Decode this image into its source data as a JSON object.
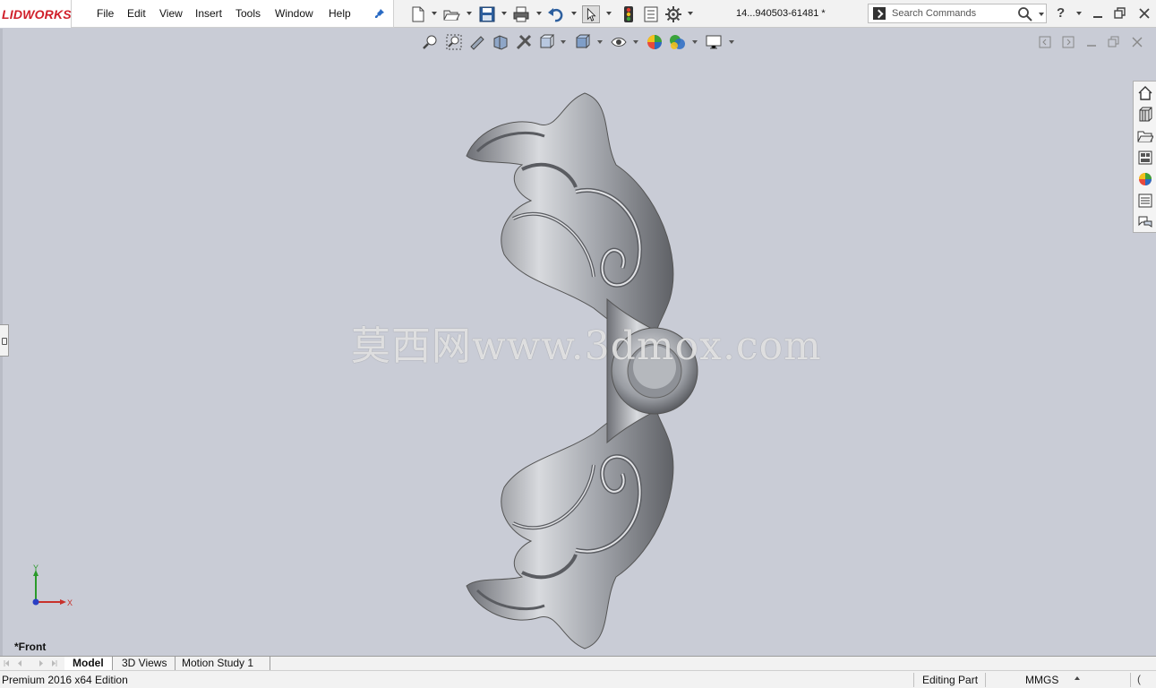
{
  "app": {
    "logo_text": "LIDWORKS",
    "document_title": "14...940503-61481 *"
  },
  "menu": {
    "items": [
      "File",
      "Edit",
      "View",
      "Insert",
      "Tools",
      "Window",
      "Help"
    ],
    "pin_icon": "pin-icon"
  },
  "toolbar": {
    "icons": [
      "new-document-icon",
      "open-icon",
      "save-icon",
      "print-icon",
      "undo-icon",
      "select-icon",
      "rebuild-icon",
      "file-properties-icon",
      "options-icon"
    ]
  },
  "search": {
    "placeholder": "Search Commands"
  },
  "help": {
    "label": "?"
  },
  "heads_up_toolbar": {
    "icons": [
      "zoom-to-fit-icon",
      "zoom-to-area-icon",
      "previous-view-icon",
      "section-view-icon",
      "dynamic-annotation-icon",
      "view-orientation-icon",
      "display-style-icon",
      "hide-show-icon",
      "edit-appearance-icon",
      "apply-scene-icon",
      "view-settings-icon"
    ]
  },
  "task_pane": {
    "icons": [
      "home-icon",
      "design-library-icon",
      "file-explorer-icon",
      "view-palette-icon",
      "appearances-icon",
      "custom-properties-icon",
      "forum-icon"
    ]
  },
  "viewport": {
    "watermark": "莫西网www.3dmox.com",
    "view_name": "*Front",
    "triad": {
      "y_label": "Y",
      "x_label": "X"
    }
  },
  "tabs": [
    {
      "label": "Model",
      "active": true
    },
    {
      "label": "3D Views",
      "active": false
    },
    {
      "label": "Motion Study 1",
      "active": false
    }
  ],
  "status": {
    "edition": "Premium 2016 x64 Edition",
    "mode": "Editing Part",
    "units": "MMGS",
    "end_glyph": "("
  },
  "colors": {
    "viewport_bg": "#c9ccd6",
    "brand_red": "#d01f2a",
    "part_metal": "#b9bcc2"
  }
}
